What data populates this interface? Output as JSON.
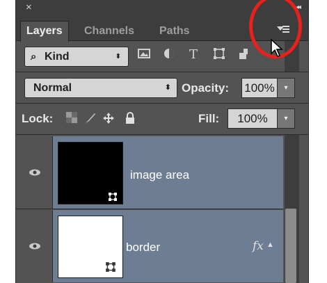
{
  "panel": {
    "close_glyph": "×",
    "collapse_glyph": "◂◂"
  },
  "tabs": [
    {
      "label": "Layers",
      "active": true
    },
    {
      "label": "Channels",
      "active": false
    },
    {
      "label": "Paths",
      "active": false
    }
  ],
  "filter": {
    "kind_label": "Kind",
    "search_icon": "magnifier-icon",
    "filter_icons": [
      "image-filter-icon",
      "adjustment-filter-icon",
      "type-filter-icon",
      "shape-filter-icon",
      "smart-object-filter-icon"
    ]
  },
  "blend": {
    "mode": "Normal",
    "opacity_label": "Opacity:",
    "opacity_value": "100%"
  },
  "lock": {
    "label": "Lock:",
    "icons": [
      "lock-transparent-icon",
      "lock-image-icon",
      "lock-position-icon",
      "lock-all-icon"
    ],
    "fill_label": "Fill:",
    "fill_value": "100%"
  },
  "layers": [
    {
      "name": "image area",
      "thumb_color": "#000000",
      "visible": true,
      "selected": true,
      "fx": false
    },
    {
      "name": "border",
      "thumb_color": "#ffffff",
      "visible": true,
      "selected": true,
      "fx": true,
      "fx_label": "fx"
    }
  ],
  "colors": {
    "panel_bg": "#535353",
    "selected_row": "#6d7d93",
    "highlight_ring": "#e8211c"
  }
}
